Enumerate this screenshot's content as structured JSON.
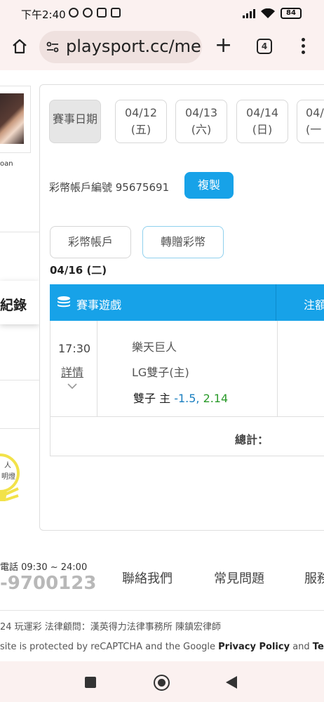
{
  "status_bar": {
    "time": "下午2:40",
    "battery": "84"
  },
  "browser": {
    "url": "playsport.cc/me",
    "tab_count": "4"
  },
  "sidebar": {
    "user_name": "oan",
    "section_title": "紀錄",
    "tip_line1": "人",
    "tip_line2": "明燈"
  },
  "dates": [
    {
      "label": "賽事日期",
      "active": true
    },
    {
      "line1": "04/12",
      "line2": "(五)"
    },
    {
      "line1": "04/13",
      "line2": "(六)"
    },
    {
      "line1": "04/14",
      "line2": "(日)"
    },
    {
      "line1": "04/",
      "line2": "(一"
    }
  ],
  "account": {
    "label": "彩幣帳戶編號 95675691",
    "copy_label": "複製"
  },
  "tabs": {
    "account_tab": "彩幣帳戶",
    "gift_tab": "轉贈彩幣"
  },
  "today_label": "04/16 (二)",
  "table": {
    "header_game": "賽事遊戲",
    "header_amount": "注額",
    "rows": [
      {
        "time": "17:30",
        "detail_label": "詳情",
        "team_away": "樂天巨人",
        "team_home": "LG雙子(主)",
        "pick_team": "雙子 主",
        "pick_handicap": "-1.5",
        "pick_sep": ",",
        "pick_odds": "2.14"
      }
    ],
    "total_label": "總計："
  },
  "footer": {
    "phone_label": "電話 09:30 ~ 24:00",
    "phone_number": "-9700123",
    "links": [
      "聯絡我們",
      "常見問題",
      "服務"
    ],
    "legal": "24 玩運彩 法律顧問：漢英得力法律事務所 陳鎮宏律師",
    "recaptcha_prefix": "site is protected by reCAPTCHA and the Google ",
    "privacy_policy": "Privacy Policy",
    "and_text": " and ",
    "terms": "Terms"
  },
  "colors": {
    "accent": "#17a2e8",
    "handicap": "#1a7fc0",
    "odds": "#2a9a2a"
  }
}
